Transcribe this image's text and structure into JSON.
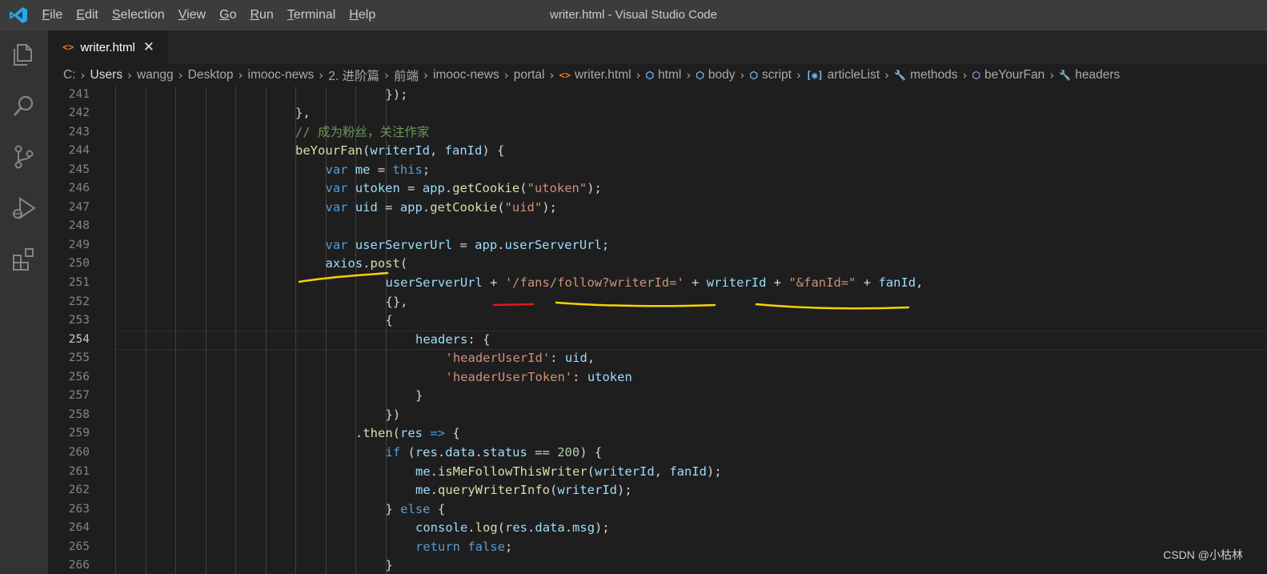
{
  "window": {
    "title": "writer.html - Visual Studio Code"
  },
  "menu": {
    "items": [
      {
        "key": "F",
        "rest": "ile"
      },
      {
        "key": "E",
        "rest": "dit"
      },
      {
        "key": "S",
        "rest": "election"
      },
      {
        "key": "V",
        "rest": "iew"
      },
      {
        "key": "G",
        "rest": "o"
      },
      {
        "key": "R",
        "rest": "un"
      },
      {
        "key": "T",
        "rest": "erminal"
      },
      {
        "key": "H",
        "rest": "elp"
      }
    ]
  },
  "tab": {
    "label": "writer.html",
    "icon": "<>",
    "close": "✕"
  },
  "breadcrumbs": {
    "items": [
      "C:",
      "Users",
      "wangg",
      "Desktop",
      "imooc-news",
      "2. 进阶篇",
      "前端",
      "imooc-news",
      "portal",
      "writer.html",
      "html",
      "body",
      "script",
      "articleList",
      "methods",
      "beYourFan",
      "headers"
    ],
    "separator": "›"
  },
  "editor": {
    "active_line": "254",
    "lines": [
      {
        "n": "241",
        "indent": 9,
        "tokens": [
          [
            "p",
            "});"
          ]
        ]
      },
      {
        "n": "242",
        "indent": 6,
        "tokens": [
          [
            "p",
            "},"
          ]
        ]
      },
      {
        "n": "243",
        "indent": 6,
        "tokens": [
          [
            "c",
            "// 成为粉丝，关注作家"
          ]
        ]
      },
      {
        "n": "244",
        "indent": 6,
        "tokens": [
          [
            "f",
            "beYourFan"
          ],
          [
            "p",
            "("
          ],
          [
            "v",
            "writerId"
          ],
          [
            "p",
            ", "
          ],
          [
            "v",
            "fanId"
          ],
          [
            "p",
            ") {"
          ]
        ]
      },
      {
        "n": "245",
        "indent": 7,
        "tokens": [
          [
            "k",
            "var"
          ],
          [
            "p",
            " "
          ],
          [
            "v",
            "me"
          ],
          [
            "p",
            " = "
          ],
          [
            "k",
            "this"
          ],
          [
            "p",
            ";"
          ]
        ]
      },
      {
        "n": "246",
        "indent": 7,
        "tokens": [
          [
            "k",
            "var"
          ],
          [
            "p",
            " "
          ],
          [
            "v",
            "utoken"
          ],
          [
            "p",
            " = "
          ],
          [
            "v",
            "app"
          ],
          [
            "p",
            "."
          ],
          [
            "f",
            "getCookie"
          ],
          [
            "p",
            "("
          ],
          [
            "s",
            "\"utoken\""
          ],
          [
            "p",
            ");"
          ]
        ]
      },
      {
        "n": "247",
        "indent": 7,
        "tokens": [
          [
            "k",
            "var"
          ],
          [
            "p",
            " "
          ],
          [
            "v",
            "uid"
          ],
          [
            "p",
            " = "
          ],
          [
            "v",
            "app"
          ],
          [
            "p",
            "."
          ],
          [
            "f",
            "getCookie"
          ],
          [
            "p",
            "("
          ],
          [
            "s",
            "\"uid\""
          ],
          [
            "p",
            ");"
          ]
        ]
      },
      {
        "n": "248",
        "indent": 7,
        "tokens": []
      },
      {
        "n": "249",
        "indent": 7,
        "tokens": [
          [
            "k",
            "var"
          ],
          [
            "p",
            " "
          ],
          [
            "v",
            "userServerUrl"
          ],
          [
            "p",
            " = "
          ],
          [
            "v",
            "app"
          ],
          [
            "p",
            "."
          ],
          [
            "v",
            "userServerUrl"
          ],
          [
            "p",
            ";"
          ]
        ]
      },
      {
        "n": "250",
        "indent": 7,
        "tokens": [
          [
            "v",
            "axios"
          ],
          [
            "p",
            "."
          ],
          [
            "f",
            "post"
          ],
          [
            "p",
            "("
          ]
        ]
      },
      {
        "n": "251",
        "indent": 9,
        "tokens": [
          [
            "v",
            "userServerUrl"
          ],
          [
            "p",
            " + "
          ],
          [
            "s",
            "'/fans/follow?writerId='"
          ],
          [
            "p",
            " + "
          ],
          [
            "v",
            "writerId"
          ],
          [
            "p",
            " + "
          ],
          [
            "s",
            "\"&fanId=\""
          ],
          [
            "p",
            " + "
          ],
          [
            "v",
            "fanId"
          ],
          [
            "p",
            ","
          ]
        ]
      },
      {
        "n": "252",
        "indent": 9,
        "tokens": [
          [
            "p",
            "{},"
          ]
        ]
      },
      {
        "n": "253",
        "indent": 9,
        "tokens": [
          [
            "p",
            "{"
          ]
        ]
      },
      {
        "n": "254",
        "indent": 10,
        "tokens": [
          [
            "v",
            "headers"
          ],
          [
            "p",
            ": {"
          ]
        ]
      },
      {
        "n": "255",
        "indent": 11,
        "tokens": [
          [
            "s",
            "'headerUserId'"
          ],
          [
            "p",
            ": "
          ],
          [
            "v",
            "uid"
          ],
          [
            "p",
            ","
          ]
        ]
      },
      {
        "n": "256",
        "indent": 11,
        "tokens": [
          [
            "s",
            "'headerUserToken'"
          ],
          [
            "p",
            ": "
          ],
          [
            "v",
            "utoken"
          ]
        ]
      },
      {
        "n": "257",
        "indent": 10,
        "tokens": [
          [
            "p",
            "}"
          ]
        ]
      },
      {
        "n": "258",
        "indent": 9,
        "tokens": [
          [
            "p",
            "})"
          ]
        ]
      },
      {
        "n": "259",
        "indent": 8,
        "tokens": [
          [
            "p",
            "."
          ],
          [
            "f",
            "then"
          ],
          [
            "p",
            "("
          ],
          [
            "v",
            "res"
          ],
          [
            "p",
            " "
          ],
          [
            "k",
            "=>"
          ],
          [
            "p",
            " {"
          ]
        ]
      },
      {
        "n": "260",
        "indent": 9,
        "tokens": [
          [
            "k",
            "if"
          ],
          [
            "p",
            " ("
          ],
          [
            "v",
            "res"
          ],
          [
            "p",
            "."
          ],
          [
            "v",
            "data"
          ],
          [
            "p",
            "."
          ],
          [
            "v",
            "status"
          ],
          [
            "p",
            " == "
          ],
          [
            "n",
            "200"
          ],
          [
            "p",
            ") {"
          ]
        ]
      },
      {
        "n": "261",
        "indent": 10,
        "tokens": [
          [
            "v",
            "me"
          ],
          [
            "p",
            "."
          ],
          [
            "f",
            "isMeFollowThisWriter"
          ],
          [
            "p",
            "("
          ],
          [
            "v",
            "writerId"
          ],
          [
            "p",
            ", "
          ],
          [
            "v",
            "fanId"
          ],
          [
            "p",
            ");"
          ]
        ]
      },
      {
        "n": "262",
        "indent": 10,
        "tokens": [
          [
            "v",
            "me"
          ],
          [
            "p",
            "."
          ],
          [
            "f",
            "queryWriterInfo"
          ],
          [
            "p",
            "("
          ],
          [
            "v",
            "writerId"
          ],
          [
            "p",
            ");"
          ]
        ]
      },
      {
        "n": "263",
        "indent": 9,
        "tokens": [
          [
            "p",
            "} "
          ],
          [
            "k",
            "else"
          ],
          [
            "p",
            " {"
          ]
        ]
      },
      {
        "n": "264",
        "indent": 10,
        "tokens": [
          [
            "v",
            "console"
          ],
          [
            "p",
            "."
          ],
          [
            "f",
            "log"
          ],
          [
            "p",
            "("
          ],
          [
            "v",
            "res"
          ],
          [
            "p",
            "."
          ],
          [
            "v",
            "data"
          ],
          [
            "p",
            "."
          ],
          [
            "v",
            "msg"
          ],
          [
            "p",
            ");"
          ]
        ]
      },
      {
        "n": "265",
        "indent": 10,
        "tokens": [
          [
            "k",
            "return"
          ],
          [
            "p",
            " "
          ],
          [
            "k",
            "false"
          ],
          [
            "p",
            ";"
          ]
        ]
      },
      {
        "n": "266",
        "indent": 9,
        "tokens": [
          [
            "p",
            "}"
          ]
        ]
      }
    ]
  },
  "watermark": "CSDN @小枯林",
  "colors": {
    "annotation_yellow": "#f5d400",
    "annotation_red": "#e0191b",
    "accent_blue": "#23a9f2"
  }
}
